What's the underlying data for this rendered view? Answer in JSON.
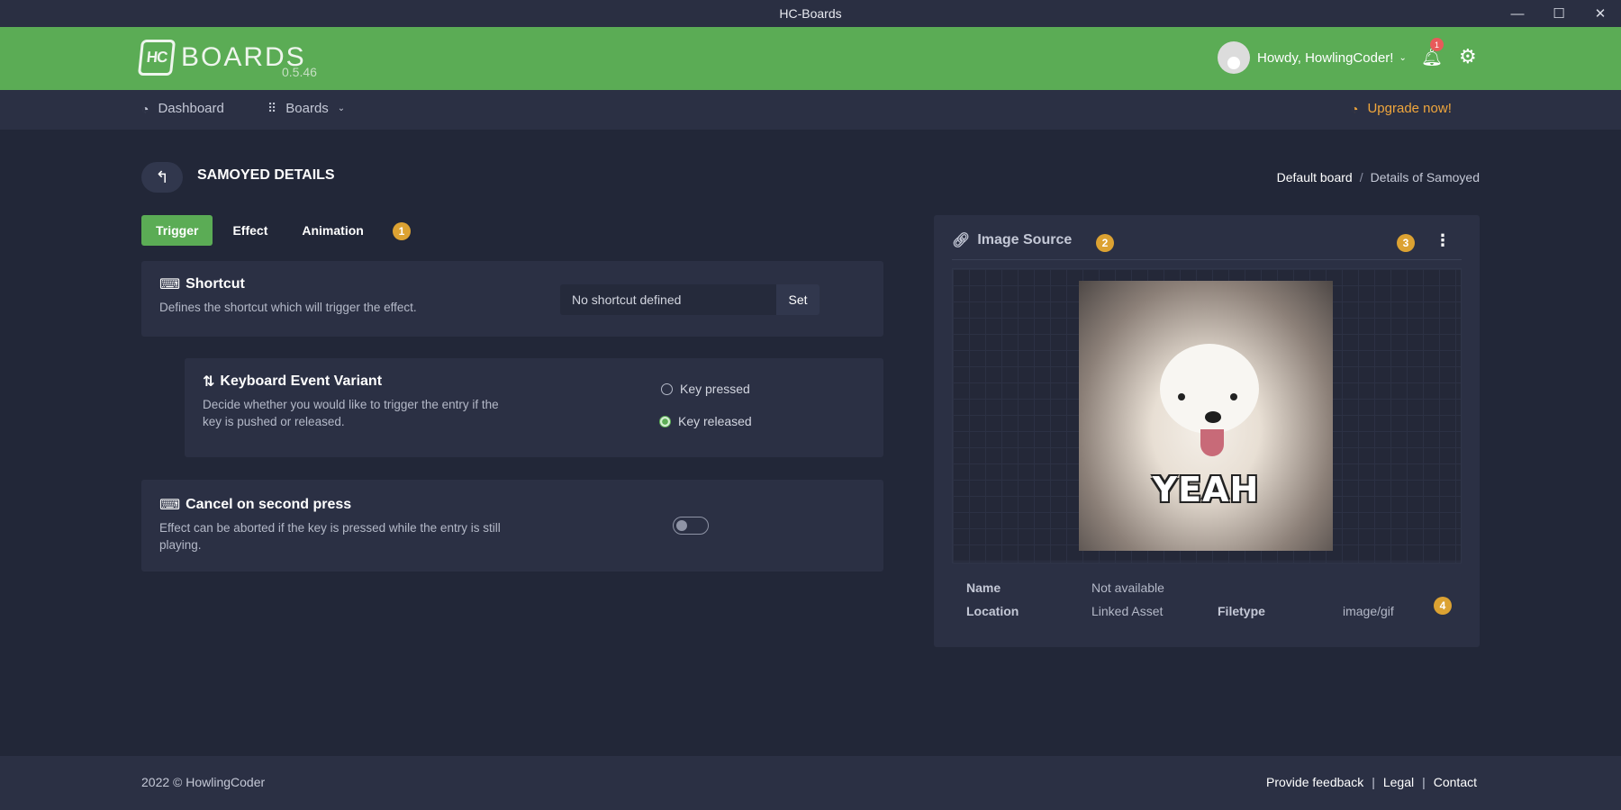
{
  "window": {
    "title": "HC-Boards",
    "minimize": "—",
    "maximize": "☐",
    "close": "✕"
  },
  "header": {
    "logo_mark": "HC",
    "logo_text": "BOARDS",
    "version": "0.5.46",
    "user_greeting": "Howdy, HowlingCoder!",
    "notification_count": "1",
    "accent_color": "#5bac55"
  },
  "nav": {
    "dashboard": "Dashboard",
    "boards": "Boards",
    "upgrade": "Upgrade now!"
  },
  "page": {
    "title": "SAMOYED DETAILS",
    "breadcrumb": {
      "root": "Default board",
      "separator": "/",
      "current": "Details of Samoyed"
    }
  },
  "tabs": [
    {
      "label": "Trigger",
      "active": true
    },
    {
      "label": "Effect",
      "active": false
    },
    {
      "label": "Animation",
      "active": false
    }
  ],
  "badges": {
    "b1": "1",
    "b2": "2",
    "b3": "3",
    "b4": "4"
  },
  "shortcut": {
    "title": "Shortcut",
    "description": "Defines the shortcut which will trigger the effect.",
    "value": "No shortcut defined",
    "set_label": "Set"
  },
  "keyboard_variant": {
    "title": "Keyboard Event Variant",
    "description": "Decide whether you would like to trigger the entry if the key is pushed or released.",
    "options": [
      {
        "label": "Key pressed",
        "selected": false
      },
      {
        "label": "Key released",
        "selected": true
      }
    ]
  },
  "cancel": {
    "title": "Cancel on second press",
    "description": "Effect can be aborted if the key is pressed while the entry is still playing.",
    "enabled": false
  },
  "image_source": {
    "title": "Image Source",
    "gif_caption": "YEAH",
    "details": {
      "name_label": "Name",
      "name_value": "Not available",
      "location_label": "Location",
      "location_value": "Linked Asset",
      "filetype_label": "Filetype",
      "filetype_value": "image/gif"
    }
  },
  "footer": {
    "copyright": "2022 © HowlingCoder",
    "links": [
      "Provide feedback",
      "Legal",
      "Contact"
    ],
    "separator": "|"
  }
}
